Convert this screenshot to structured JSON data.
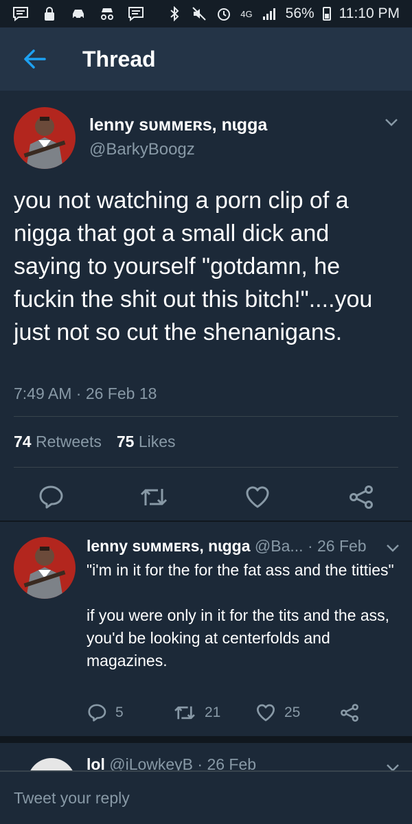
{
  "status_bar": {
    "battery": "56%",
    "time": "11:10 PM",
    "network": "4G"
  },
  "header": {
    "title": "Thread"
  },
  "main_tweet": {
    "name": "lenny sᴜᴍᴍᴇʀs, nɩgga",
    "handle": "@BarkyBoogz",
    "text": "you not watching a porn clip of a nigga that got a small dick and saying to yourself \"gotdamn, he fuckin the shit out this bitch!\"....you just not so cut the shenanigans.",
    "timestamp": "7:49 AM · 26 Feb 18",
    "retweets_count": "74",
    "retweets_label": "Retweets",
    "likes_count": "75",
    "likes_label": "Likes"
  },
  "reply_tweet": {
    "name": "lenny sᴜᴍᴍᴇʀs, nɩgga",
    "handle_date": "@Ba... · 26 Feb",
    "text": "\"i'm in it for the for the fat ass and the titties\"\n\nif you were only in it for the tits and the ass, you'd be looking at centerfolds and magazines.",
    "replies": "5",
    "retweets": "21",
    "likes": "25"
  },
  "next_tweet": {
    "name": "lol",
    "handle_date": "@iLowkeyB · 26 Feb"
  },
  "compose": {
    "placeholder": "Tweet your reply"
  },
  "colors": {
    "background": "#1c2938",
    "header": "#243447",
    "accent": "#1da1f2",
    "muted": "#8899a6"
  }
}
